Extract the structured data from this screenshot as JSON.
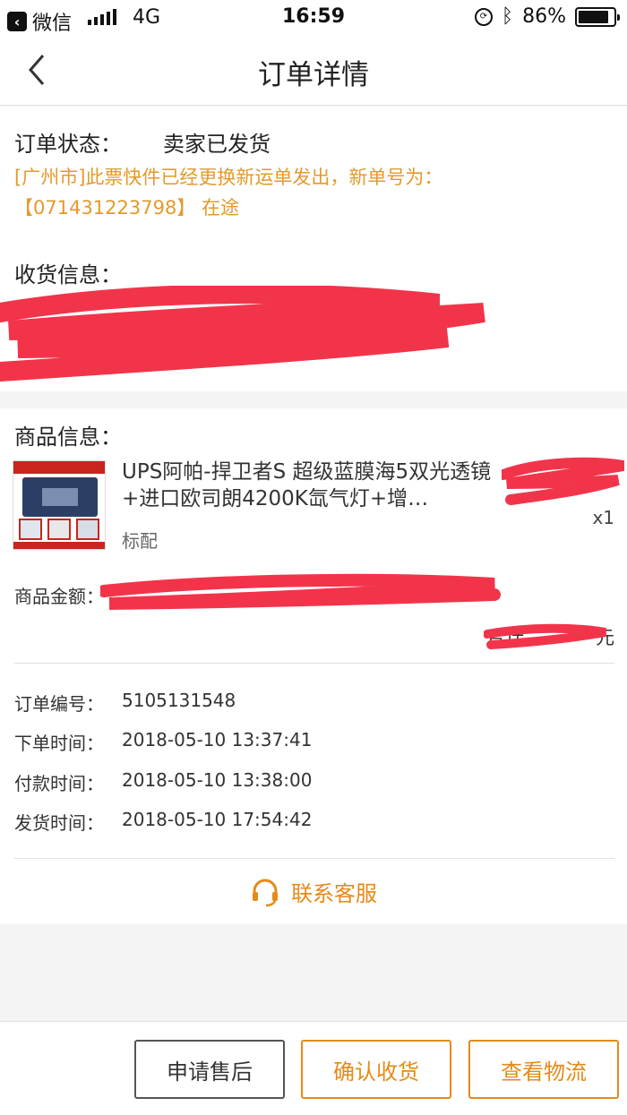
{
  "status_bar": {
    "app_back": "微信",
    "network": "4G",
    "time": "16:59",
    "battery": "86%",
    "battery_level": 0.86
  },
  "nav": {
    "title": "订单详情"
  },
  "order_status": {
    "label": "订单状态：",
    "value": "卖家已发货",
    "notice_line1": "[广州市]此票快件已经更换新运单发出，新单号为：",
    "notice_line2": "【071431223798】 在途"
  },
  "receiver": {
    "label": "收货信息："
  },
  "goods": {
    "label": "商品信息：",
    "title": "UPS阿帕-捍卫者S 超级蓝膜海5双光透镜+进口欧司朗4200K氙气灯+增…",
    "spec": "标配",
    "qty": "x1",
    "amount_label": "商品金额：",
    "total_label": "合计",
    "total_unit": "元"
  },
  "order_info": {
    "rows": [
      {
        "key": "订单编号：",
        "value": "5105131548"
      },
      {
        "key": "下单时间：",
        "value": "2018-05-10 13:37:41"
      },
      {
        "key": "付款时间：",
        "value": "2018-05-10 13:38:00"
      },
      {
        "key": "发货时间：",
        "value": "2018-05-10 17:54:42"
      }
    ],
    "service_label": "联系客服"
  },
  "actions": {
    "after_sale": "申请售后",
    "confirm_receipt": "确认收货",
    "view_logistics": "查看物流"
  },
  "colors": {
    "accent": "#e58a18",
    "notice": "#e39a2b",
    "redaction": "#f2344b"
  }
}
